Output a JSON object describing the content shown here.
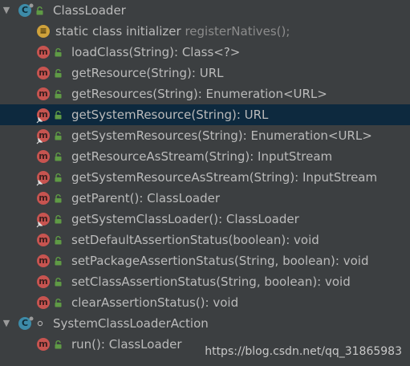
{
  "tree": {
    "class_loader": {
      "label": "ClassLoader",
      "expand_glyph": "▼",
      "members": [
        {
          "name": "static class initializer",
          "secondary": "registerNatives();"
        },
        {
          "label": "loadClass(String): Class<?>"
        },
        {
          "label": "getResource(String): URL"
        },
        {
          "label": "getResources(String): Enumeration<URL>"
        },
        {
          "label": "getSystemResource(String): URL"
        },
        {
          "label": "getSystemResources(String): Enumeration<URL>"
        },
        {
          "label": "getResourceAsStream(String): InputStream"
        },
        {
          "label": "getSystemResourceAsStream(String): InputStream"
        },
        {
          "label": "getParent(): ClassLoader"
        },
        {
          "label": "getSystemClassLoader(): ClassLoader"
        },
        {
          "label": "setDefaultAssertionStatus(boolean): void"
        },
        {
          "label": "setPackageAssertionStatus(String, boolean): void"
        },
        {
          "label": "setClassAssertionStatus(String, boolean): void"
        },
        {
          "label": "clearAssertionStatus(): void"
        }
      ]
    },
    "system_class_loader_action": {
      "label": "SystemClassLoaderAction",
      "expand_glyph": "▼",
      "members": [
        {
          "label": "run(): ClassLoader"
        }
      ]
    }
  },
  "icons": {
    "method_letter": "m",
    "class_letter": "C",
    "initializer_letter": "≡"
  },
  "colors": {
    "background": "#3c3f41",
    "selection": "#0d293e",
    "text": "#bbbbbb",
    "method_icon": "#c75450",
    "class_icon": "#3d8ba8",
    "lock_green": "#5f9b45"
  },
  "watermark": "https://blog.csdn.net/qq_31865983"
}
